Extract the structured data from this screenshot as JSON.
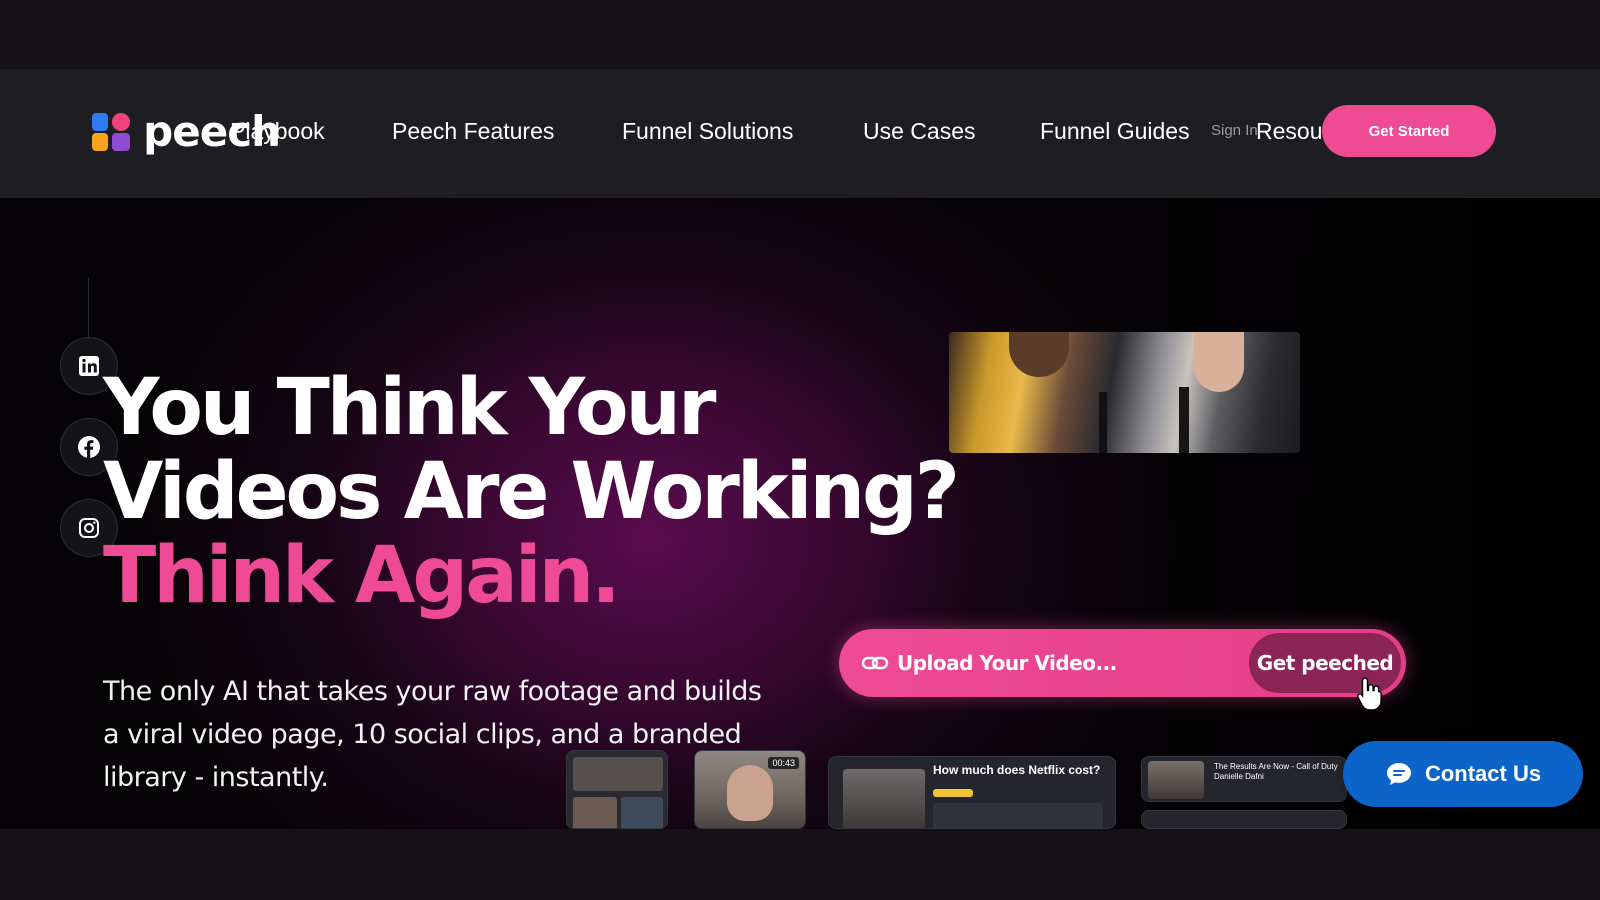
{
  "header": {
    "logo_text": "peech",
    "nav": {
      "playbook": "Playbook",
      "features": "Peech Features",
      "solutions": "Funnel Solutions",
      "use_cases": "Use Cases",
      "guides": "Funnel Guides",
      "sign_in": "Sign In",
      "resources": "Resources"
    },
    "cta": "Get Started"
  },
  "hero": {
    "headline_line1": "You Think Your",
    "headline_line2": "Videos Are Working?",
    "headline_accent": "Think Again.",
    "subtext": "The only AI that takes your raw footage and builds a viral video page, 10 social clips, and a branded library - instantly.",
    "upload_placeholder": "Upload Your Video...",
    "upload_button": "Get peeched"
  },
  "social": [
    "linkedin-icon",
    "facebook-icon",
    "instagram-icon"
  ],
  "previews": {
    "thumb2_duration": "00:43",
    "thumb3_title": "How much does Netflix cost?",
    "thumb4_title": "The Results Are Now - Call of Duty Danielle Dafni"
  },
  "contact_button": "Contact Us",
  "colors": {
    "accent": "#ef4a95",
    "contact": "#0c64c9",
    "header_bg": "#1e1e22"
  }
}
